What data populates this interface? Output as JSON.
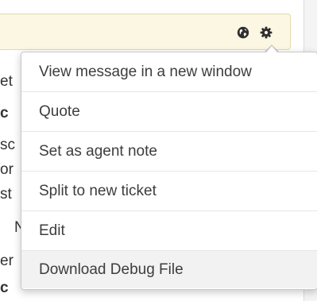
{
  "background_text": [
    {
      "text": "et",
      "bold": false
    },
    {
      "text": "c",
      "bold": true
    },
    {
      "text": "sc",
      "bold": false
    },
    {
      "text": "or",
      "bold": false
    },
    {
      "text": "st",
      "bold": false
    },
    {
      "text": "N",
      "bold": false
    },
    {
      "text": "er",
      "bold": false
    },
    {
      "text": "c",
      "bold": true
    }
  ],
  "header": {
    "globe_icon": "globe-icon",
    "gear_icon": "gear-icon"
  },
  "menu": {
    "items": [
      {
        "label": "View message in a new window"
      },
      {
        "label": "Quote"
      },
      {
        "label": "Set as agent note"
      },
      {
        "label": "Split to new ticket"
      },
      {
        "label": "Edit"
      },
      {
        "label": "Download Debug File"
      }
    ]
  },
  "colors": {
    "header_bg": "#fcf7e3",
    "header_border": "#e4d9ad",
    "icon": "#2f2f2f",
    "menu_text": "#3d3d3d",
    "menu_hover": "#f2f2f2"
  }
}
